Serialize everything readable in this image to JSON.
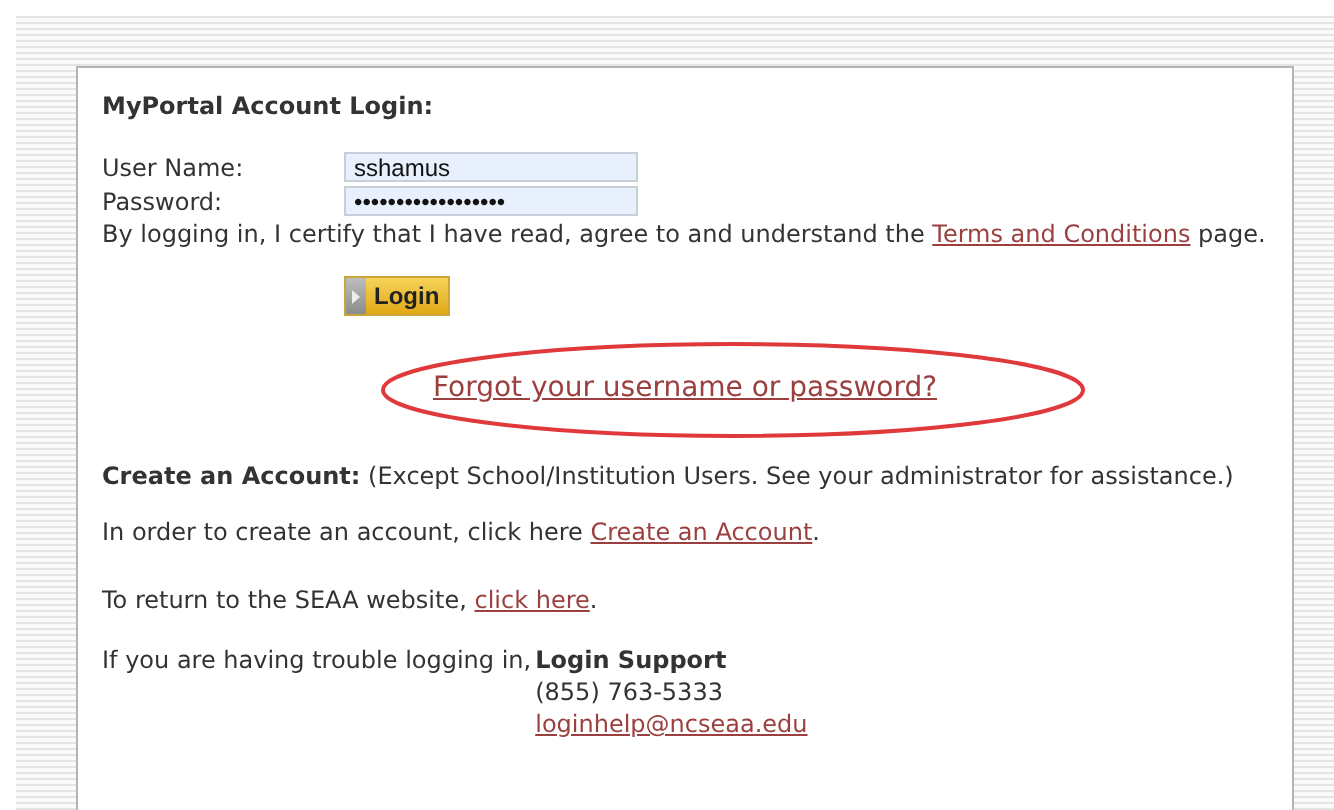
{
  "title": "MyPortal Account Login:",
  "fields": [
    {
      "label": "User Name:",
      "value": "sshamus"
    },
    {
      "label": "Password:",
      "value": "••••••••••••••••••"
    }
  ],
  "certify": {
    "before": "By logging in, I certify that I have read, agree to and understand the ",
    "link": "Terms and Conditions",
    "after": " page."
  },
  "login_button": "Login",
  "forgot_link": {
    "text": "Forgot your username or password?",
    "highlighted": true
  },
  "create_heading": "**Create an Account:** (Except School/Institution Users. See your administrator for assistance.)",
  "create_line": {
    "before": "In order to create an account, click here ",
    "link": "Create an Account",
    "after": "."
  },
  "return_line": {
    "before": "To return to the SEAA website, ",
    "link": "click here",
    "after": "."
  },
  "support": {
    "intro": "If you are having trouble logging in,",
    "heading": "Login Support",
    "phone": "(855) 763-5333",
    "email": "loginhelp@ncseaa.edu"
  }
}
